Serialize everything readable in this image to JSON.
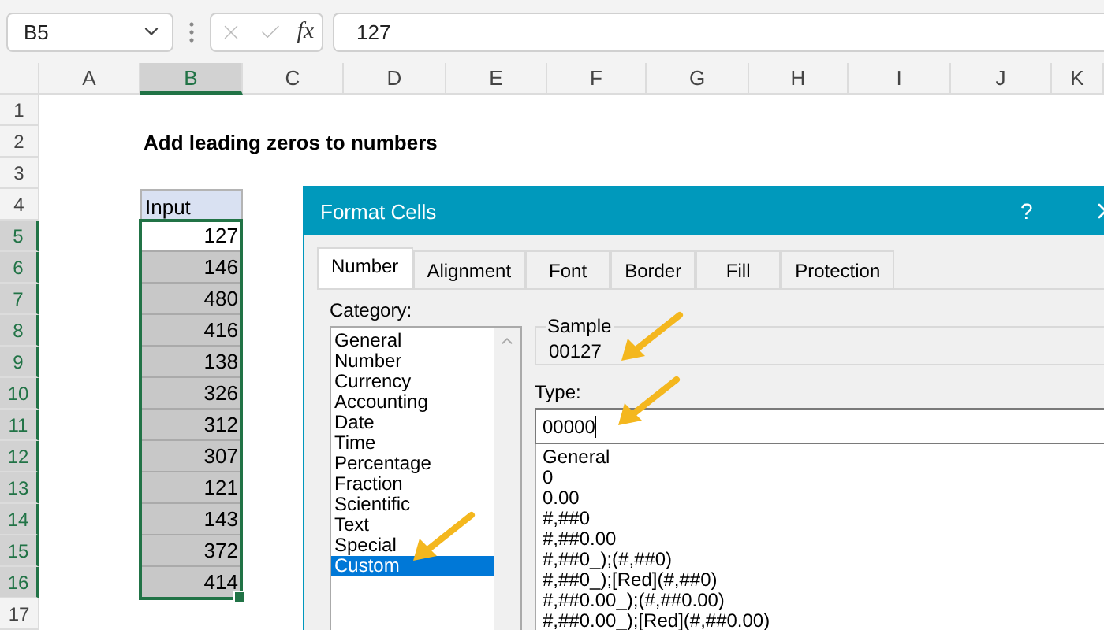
{
  "name_box": "B5",
  "formula_bar": {
    "fx_label": "fx",
    "value": "127"
  },
  "columns": [
    {
      "label": "A",
      "selected": false
    },
    {
      "label": "B",
      "selected": true
    },
    {
      "label": "C",
      "selected": false
    },
    {
      "label": "D",
      "selected": false
    },
    {
      "label": "E",
      "selected": false
    },
    {
      "label": "F",
      "selected": false
    },
    {
      "label": "G",
      "selected": false
    },
    {
      "label": "H",
      "selected": false
    },
    {
      "label": "I",
      "selected": false
    },
    {
      "label": "J",
      "selected": false
    },
    {
      "label": "K",
      "selected": false
    }
  ],
  "rows": [
    {
      "label": "1",
      "selected": false
    },
    {
      "label": "2",
      "selected": false
    },
    {
      "label": "3",
      "selected": false
    },
    {
      "label": "4",
      "selected": false
    },
    {
      "label": "5",
      "selected": true
    },
    {
      "label": "6",
      "selected": true
    },
    {
      "label": "7",
      "selected": true
    },
    {
      "label": "8",
      "selected": true
    },
    {
      "label": "9",
      "selected": true
    },
    {
      "label": "10",
      "selected": true
    },
    {
      "label": "11",
      "selected": true
    },
    {
      "label": "12",
      "selected": true
    },
    {
      "label": "13",
      "selected": true
    },
    {
      "label": "14",
      "selected": true
    },
    {
      "label": "15",
      "selected": true
    },
    {
      "label": "16",
      "selected": true
    },
    {
      "label": "17",
      "selected": false
    }
  ],
  "sheet": {
    "title": "Add leading zeros to numbers",
    "header": "Input",
    "values": [
      {
        "value": "127",
        "active": true
      },
      {
        "value": "146",
        "active": false
      },
      {
        "value": "480",
        "active": false
      },
      {
        "value": "416",
        "active": false
      },
      {
        "value": "138",
        "active": false
      },
      {
        "value": "326",
        "active": false
      },
      {
        "value": "312",
        "active": false
      },
      {
        "value": "307",
        "active": false
      },
      {
        "value": "121",
        "active": false
      },
      {
        "value": "143",
        "active": false
      },
      {
        "value": "372",
        "active": false
      },
      {
        "value": "414",
        "active": false
      }
    ]
  },
  "dialog": {
    "title": "Format Cells",
    "help": "?",
    "tabs": [
      {
        "label": "Number",
        "selected": true
      },
      {
        "label": "Alignment",
        "selected": false
      },
      {
        "label": "Font",
        "selected": false
      },
      {
        "label": "Border",
        "selected": false
      },
      {
        "label": "Fill",
        "selected": false
      },
      {
        "label": "Protection",
        "selected": false
      }
    ],
    "category_label": "Category:",
    "categories": [
      {
        "label": "General",
        "selected": false
      },
      {
        "label": "Number",
        "selected": false
      },
      {
        "label": "Currency",
        "selected": false
      },
      {
        "label": "Accounting",
        "selected": false
      },
      {
        "label": "Date",
        "selected": false
      },
      {
        "label": "Time",
        "selected": false
      },
      {
        "label": "Percentage",
        "selected": false
      },
      {
        "label": "Fraction",
        "selected": false
      },
      {
        "label": "Scientific",
        "selected": false
      },
      {
        "label": "Text",
        "selected": false
      },
      {
        "label": "Special",
        "selected": false
      },
      {
        "label": "Custom",
        "selected": true
      }
    ],
    "sample_label": "Sample",
    "sample": "00127",
    "type_label": "Type:",
    "type_value": "00000",
    "formats": [
      "General",
      "0",
      "0.00",
      "#,##0",
      "#,##0.00",
      "#,##0_);(#,##0)",
      "#,##0_);[Red](#,##0)",
      "#,##0.00_);(#,##0.00)",
      "#,##0.00_);[Red](#,##0.00)"
    ]
  }
}
